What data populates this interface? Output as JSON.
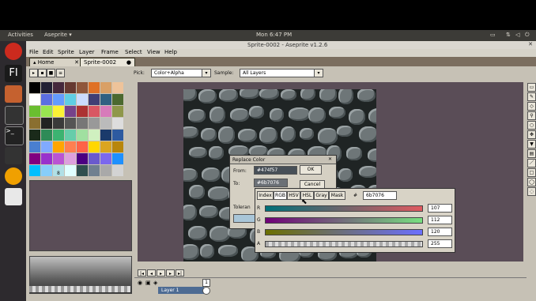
{
  "topbar": {
    "activities": "Activities",
    "app": "Aseprite ▾",
    "clock": "Mon  6:47 PM"
  },
  "window": {
    "title": "Sprite-0002 - Aseprite v1.2.6"
  },
  "menu": [
    "File",
    "Edit",
    "Sprite",
    "Layer",
    "Frame",
    "Select",
    "View",
    "Help"
  ],
  "tabs": [
    {
      "label": "Home"
    },
    {
      "label": "Sprite-0002"
    }
  ],
  "toolbar": {
    "pick_label": "Pick:",
    "pick_value": "Color+Alpha",
    "sample_label": "Sample:",
    "sample_value": "All Layers"
  },
  "palette": {
    "colors": [
      "#000000",
      "#222034",
      "#45283c",
      "#663931",
      "#8f563b",
      "#df7126",
      "#d9a066",
      "#eec39a",
      "#ffffff",
      "#5b6ee1",
      "#639bff",
      "#5fcde4",
      "#cbdbfc",
      "#3f3f74",
      "#306082",
      "#4b692f",
      "#6abe30",
      "#99e550",
      "#fbf236",
      "#76428a",
      "#ac3232",
      "#d95763",
      "#d77bba",
      "#8f974a",
      "#8a6f30",
      "#222222",
      "#3a3a3a",
      "#555555",
      "#777777",
      "#999999",
      "#bbbbbb",
      "#dddddd",
      "#1a2a1a",
      "#2e8b57",
      "#3cb371",
      "#66cdaa",
      "#a0e0a0",
      "#d0f0c0",
      "#1b3a6b",
      "#2d5aa0",
      "#4a7fd0",
      "#80aaff",
      "#ffa500",
      "#ff7f50",
      "#ff6347",
      "#ffd700",
      "#daa520",
      "#b8860b",
      "#800080",
      "#9932cc",
      "#ba55d3",
      "#dda0dd",
      "#4b0082",
      "#6a5acd",
      "#7b68ee",
      "#1e90ff",
      "#00bfff",
      "#87cefa",
      "#b0e0e6",
      "#e0ffff",
      "#2f4f4f",
      "#708090",
      "#a9a9a9",
      "#d3d3d3"
    ],
    "index_label": "8"
  },
  "replace": {
    "title": "Replace Color",
    "from_label": "From:",
    "from_value": "#474f57",
    "to_label": "To:",
    "to_value": "#6b7076",
    "ok": "OK",
    "cancel": "Cancel",
    "tolerance_label": "Toleran"
  },
  "colorpop": {
    "tabs": [
      "Index",
      "RGB",
      "HSV",
      "HSL",
      "Gray",
      "Mask"
    ],
    "hex_symbol": "#",
    "hex": "6b7076",
    "channels": [
      {
        "name": "R",
        "value": "107"
      },
      {
        "name": "G",
        "value": "112"
      },
      {
        "name": "B",
        "value": "120"
      },
      {
        "name": "A",
        "value": "255"
      }
    ]
  },
  "timeline": {
    "frame": "1",
    "layer": "Layer 1"
  }
}
